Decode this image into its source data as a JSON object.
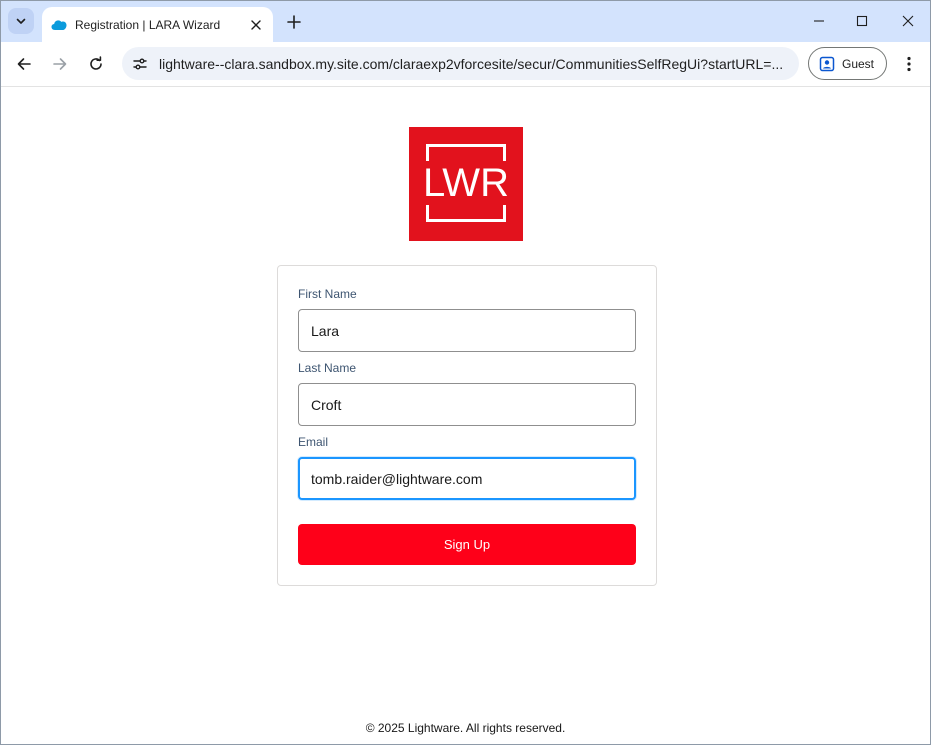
{
  "browser": {
    "tab_title": "Registration | LARA Wizard",
    "new_tab_symbol": "+",
    "url": "lightware--clara.sandbox.my.site.com/claraexp2vforcesite/secur/CommunitiesSelfRegUi?startURL=...",
    "profile_label": "Guest"
  },
  "logo": {
    "text": "LWR",
    "brand_color": "#e2121d"
  },
  "form": {
    "first_name_label": "First Name",
    "first_name_value": "Lara",
    "last_name_label": "Last Name",
    "last_name_value": "Croft",
    "email_label": "Email",
    "email_value": "tomb.raider@lightware.com",
    "signup_label": "Sign Up",
    "accent_color": "#fe0019",
    "focus_color": "#1b96ff"
  },
  "footer": {
    "copyright": "© 2025 Lightware. All rights reserved."
  },
  "icons": {
    "tab_search": "chevron-down-icon",
    "favicon": "salesforce-cloud-icon",
    "tab_close": "close-icon",
    "back": "arrow-left-icon",
    "forward": "arrow-right-icon",
    "reload": "reload-icon",
    "site_info": "tune-icon",
    "profile": "profile-icon",
    "menu": "kebab-menu-icon",
    "minimize": "minimize-icon",
    "maximize": "maximize-icon",
    "close_window": "close-icon"
  }
}
